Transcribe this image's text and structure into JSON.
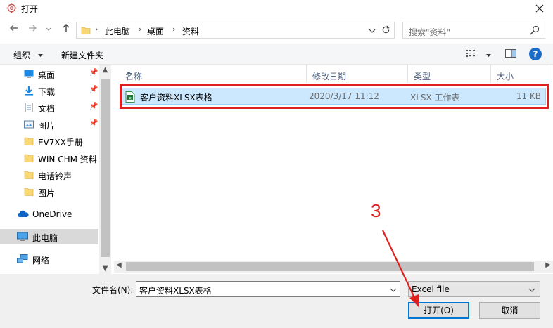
{
  "window": {
    "title": "打开"
  },
  "address": {
    "crumbs": [
      "此电脑",
      "桌面",
      "资料"
    ]
  },
  "search": {
    "placeholder": "搜索\"资料\""
  },
  "toolbar": {
    "organize": "组织",
    "new_folder": "新建文件夹"
  },
  "nav": {
    "items": [
      {
        "label": "桌面",
        "icon": "desktop-icon",
        "pinned": true
      },
      {
        "label": "下载",
        "icon": "download-icon",
        "pinned": true
      },
      {
        "label": "文档",
        "icon": "document-icon",
        "pinned": true
      },
      {
        "label": "图片",
        "icon": "picture-icon",
        "pinned": true
      },
      {
        "label": "EV7XX手册",
        "icon": "folder-icon",
        "pinned": false
      },
      {
        "label": "WIN CHM 资料",
        "icon": "folder-icon",
        "pinned": false
      },
      {
        "label": "电话铃声",
        "icon": "folder-icon",
        "pinned": false
      },
      {
        "label": "图片",
        "icon": "folder-icon",
        "pinned": false
      },
      {
        "label": "OneDrive",
        "icon": "onedrive-icon",
        "pinned": false
      },
      {
        "label": "此电脑",
        "icon": "computer-icon",
        "pinned": false,
        "selected": true
      },
      {
        "label": "网络",
        "icon": "network-icon",
        "pinned": false
      }
    ]
  },
  "columns": {
    "name": "名称",
    "modified": "修改日期",
    "type": "类型",
    "size": "大小"
  },
  "files": [
    {
      "name": "客户资料XLSX表格",
      "modified": "2020/3/17 11:12",
      "type": "XLSX 工作表",
      "size": "11 KB",
      "selected": true
    }
  ],
  "bottom": {
    "filename_label": "文件名(N):",
    "filename_value": "客户资料XLSX表格",
    "filter_value": "Excel file",
    "open_button": "打开(O)",
    "cancel_button": "取消"
  },
  "annotation": {
    "step": "3",
    "color": "#e02020"
  },
  "colors": {
    "accent": "#0078d7",
    "selection": "#cce8ff",
    "annotation": "#e02020"
  }
}
